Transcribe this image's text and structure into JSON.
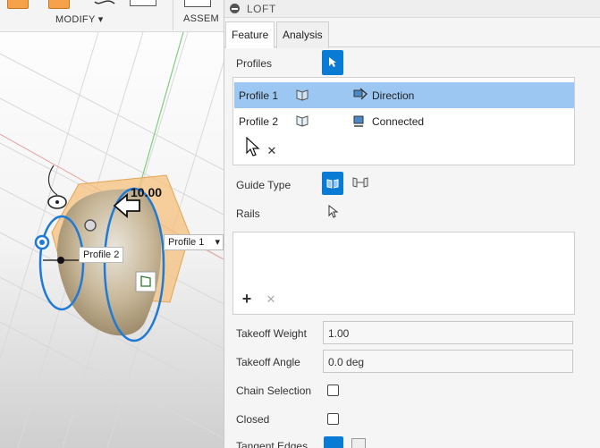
{
  "ribbon": {
    "modify_label": "MODIFY ▾",
    "assemble_label": "ASSEM"
  },
  "viewport": {
    "dimension_value": "10.00",
    "profile2_tag": "Profile 2",
    "profile1_tag": "Profile 1",
    "dropdown_arrow": "▾"
  },
  "panel": {
    "title": "LOFT",
    "tabs": [
      {
        "label": "Feature",
        "active": true
      },
      {
        "label": "Analysis",
        "active": false
      }
    ],
    "profiles_label": "Profiles",
    "profiles": [
      {
        "name": "Profile 1",
        "condition": "Direction",
        "selected": true
      },
      {
        "name": "Profile 2",
        "condition": "Connected",
        "selected": false
      }
    ],
    "remove_symbol": "✕",
    "add_symbol": "+",
    "guide_type_label": "Guide Type",
    "rails_label": "Rails",
    "takeoff_weight": {
      "label": "Takeoff Weight",
      "value": "1.00"
    },
    "takeoff_angle": {
      "label": "Takeoff Angle",
      "value": "0.0 deg"
    },
    "chain_selection": {
      "label": "Chain Selection",
      "checked": false
    },
    "closed": {
      "label": "Closed",
      "checked": false
    },
    "tangent_edges": {
      "label": "Tangent Edges"
    }
  },
  "colors": {
    "accent": "#0a7bd5",
    "selection": "#9cc7f2",
    "orange": "#f6a24a",
    "profile_blue": "#1f7ad6"
  }
}
